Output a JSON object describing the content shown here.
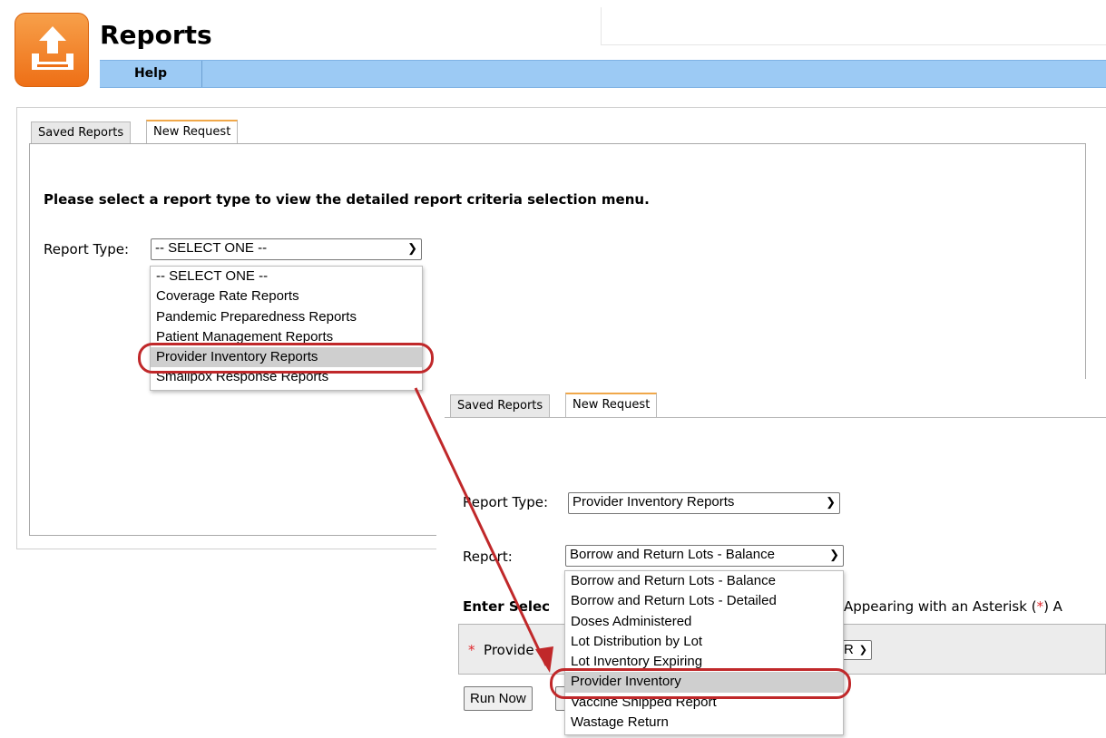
{
  "header": {
    "title": "Reports",
    "menu": {
      "help": "Help"
    }
  },
  "back": {
    "tabs": [
      {
        "label": "Saved Reports"
      },
      {
        "label": "New Request"
      }
    ],
    "instruction": "Please select a report type to view the detailed report criteria selection menu.",
    "report_type_label": "Report Type:",
    "report_type_value": "-- SELECT ONE --",
    "options": [
      "-- SELECT ONE --",
      "Coverage Rate Reports",
      "Pandemic Preparedness Reports",
      "Patient Management Reports",
      "Provider Inventory Reports",
      "Smallpox Response Reports"
    ]
  },
  "front": {
    "tabs": [
      {
        "label": "Saved Reports"
      },
      {
        "label": "New Request"
      }
    ],
    "report_type_label": "Report Type:",
    "report_type_value": "Provider Inventory Reports",
    "report_label": "Report:",
    "report_value": "Borrow and Return Lots - Balance",
    "criteria_heading_left": "Enter Selec",
    "criteria_heading_right": "Appearing with an Asterisk (",
    "asterisk": "*",
    "criteria_heading_end": ") A",
    "provider_label": "Provide",
    "provider_select_partial": "R",
    "run_now": "Run Now",
    "options": [
      "Borrow and Return Lots - Balance",
      "Borrow and Return Lots - Detailed",
      "Doses Administered",
      "Lot Distribution by Lot",
      "Lot Inventory Expiring",
      "Provider Inventory",
      "Vaccine Shipped Report",
      "Wastage Return"
    ]
  },
  "colors": {
    "accent_orange": "#ee6f16",
    "menu_blue": "#9ccaf4",
    "highlight_red": "#c0282a",
    "asterisk_red": "#e0262b"
  }
}
